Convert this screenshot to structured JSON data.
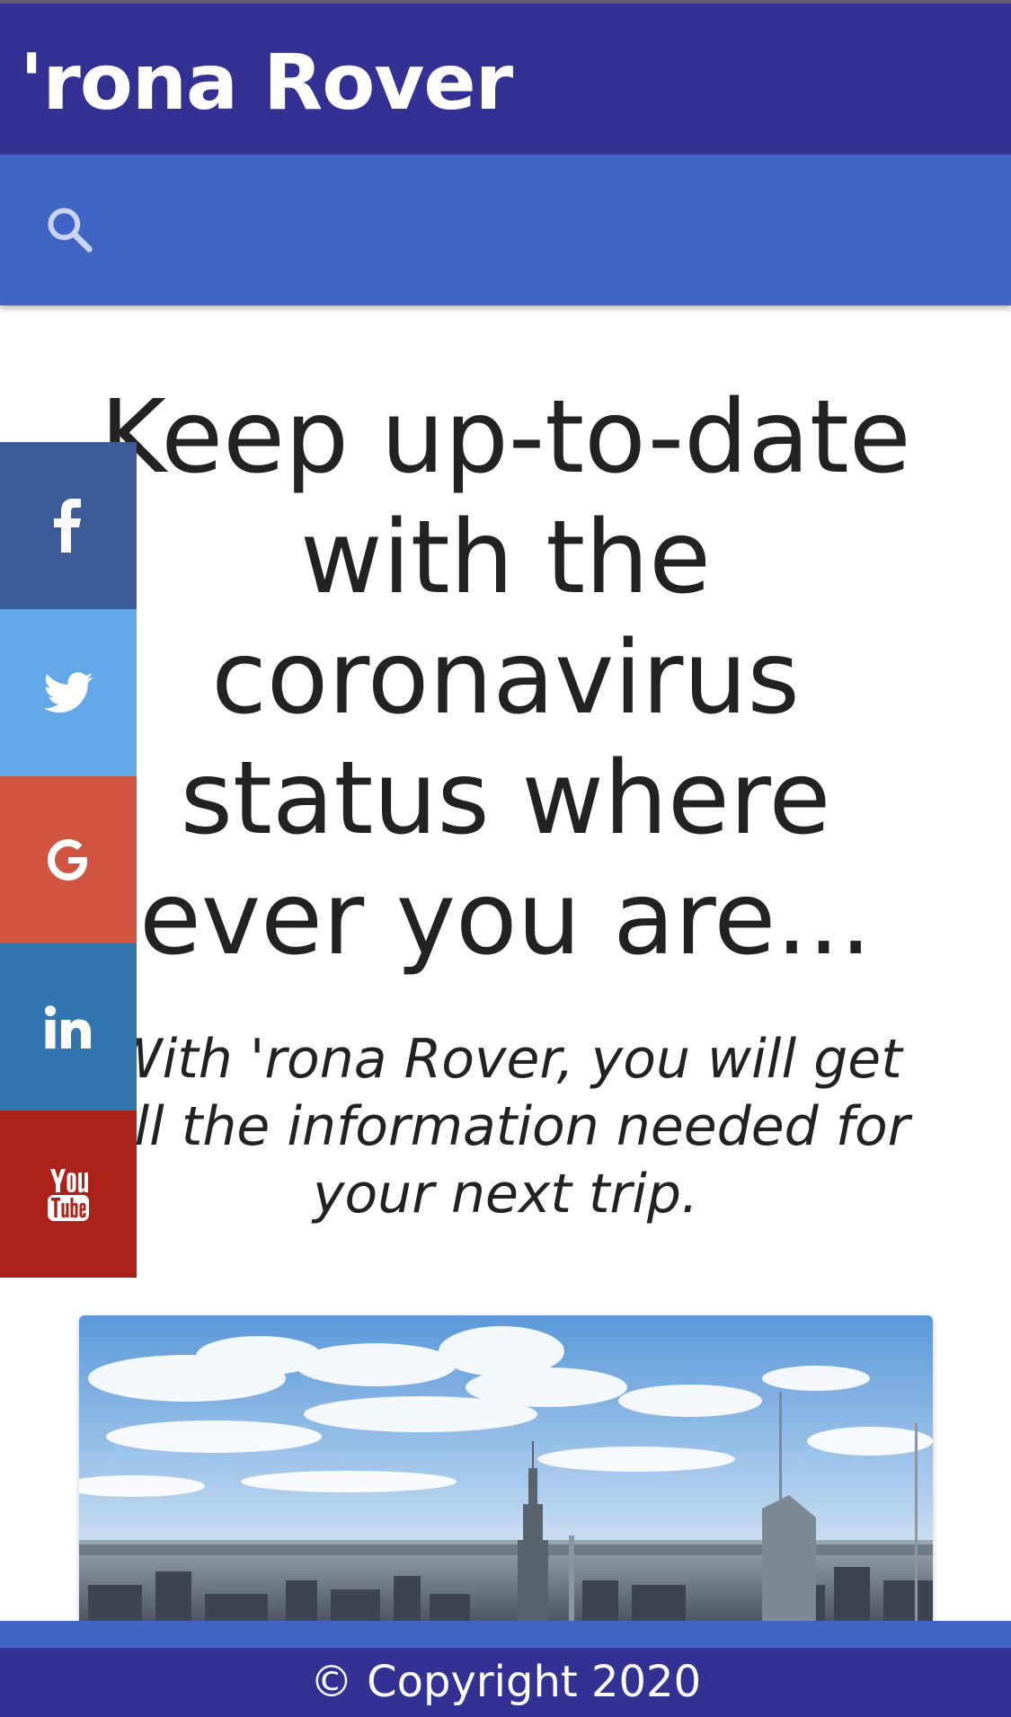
{
  "header": {
    "title": "'rona Rover"
  },
  "search": {
    "placeholder": ""
  },
  "hero": {
    "headline": "Keep up-to-date with the coronavirus status where ever you are...",
    "subheadline": "With 'rona Rover, you will get all the information needed for your next trip."
  },
  "share": {
    "items": [
      {
        "network": "facebook",
        "icon": "facebook-icon",
        "color": "#3b5b99"
      },
      {
        "network": "twitter",
        "icon": "twitter-icon",
        "color": "#62a8e9"
      },
      {
        "network": "google",
        "icon": "google-icon",
        "color": "#d05540"
      },
      {
        "network": "linkedin",
        "icon": "linkedin-icon",
        "color": "#3276b1"
      },
      {
        "network": "youtube",
        "icon": "youtube-icon",
        "color": "#ab2218"
      }
    ]
  },
  "image": {
    "subject": "city-skyline-photo"
  },
  "footer": {
    "copyright": "© Copyright 2020"
  },
  "colors": {
    "header_bg": "#343194",
    "search_bg": "#4065c5",
    "footer_bg": "#343194",
    "text": "#222222"
  }
}
